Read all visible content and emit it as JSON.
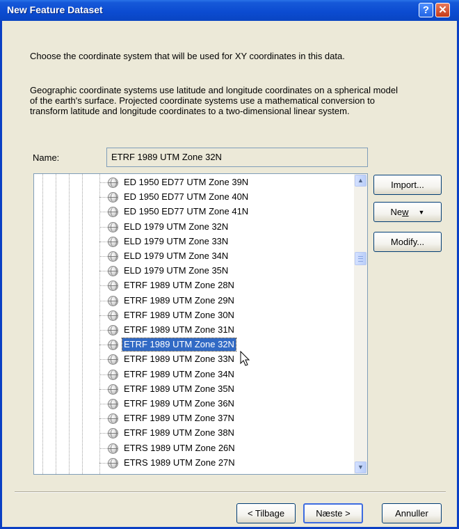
{
  "window": {
    "title": "New Feature Dataset"
  },
  "intro": {
    "line1": "Choose the coordinate system that will be used for XY coordinates in this data.",
    "para_line1": "Geographic coordinate systems use latitude and longitude coordinates on a spherical model",
    "para_line2": "of the earth's surface. Projected coordinate systems use a mathematical conversion to",
    "para_line3": "transform latitude and longitude coordinates to a two-dimensional linear system."
  },
  "name_field": {
    "label": "Name:",
    "value": "ETRF 1989 UTM Zone 32N"
  },
  "tree": {
    "items": [
      "ED 1950 ED77 UTM Zone 39N",
      "ED 1950 ED77 UTM Zone 40N",
      "ED 1950 ED77 UTM Zone 41N",
      "ELD 1979 UTM Zone 32N",
      "ELD 1979 UTM Zone 33N",
      "ELD 1979 UTM Zone 34N",
      "ELD 1979 UTM Zone 35N",
      "ETRF 1989 UTM Zone 28N",
      "ETRF 1989 UTM Zone 29N",
      "ETRF 1989 UTM Zone 30N",
      "ETRF 1989 UTM Zone 31N",
      "ETRF 1989 UTM Zone 32N",
      "ETRF 1989 UTM Zone 33N",
      "ETRF 1989 UTM Zone 34N",
      "ETRF 1989 UTM Zone 35N",
      "ETRF 1989 UTM Zone 36N",
      "ETRF 1989 UTM Zone 37N",
      "ETRF 1989 UTM Zone 38N",
      "ETRS 1989 UTM Zone 26N",
      "ETRS 1989 UTM Zone 27N"
    ],
    "selected": "ETRF 1989 UTM Zone 32N",
    "item_icon": "globe-icon",
    "scroll_fraction": 0.25
  },
  "side_buttons": {
    "import": "Import...",
    "new_prefix": "Ne",
    "new_underlined": "w",
    "modify": "Modify..."
  },
  "footer": {
    "back": "< Tilbage",
    "next": "Næste >",
    "cancel": "Annuller"
  },
  "colors": {
    "selection": "#316ac5",
    "titlebar": "#0b4bd0",
    "dialog_bg": "#ece9d8"
  }
}
